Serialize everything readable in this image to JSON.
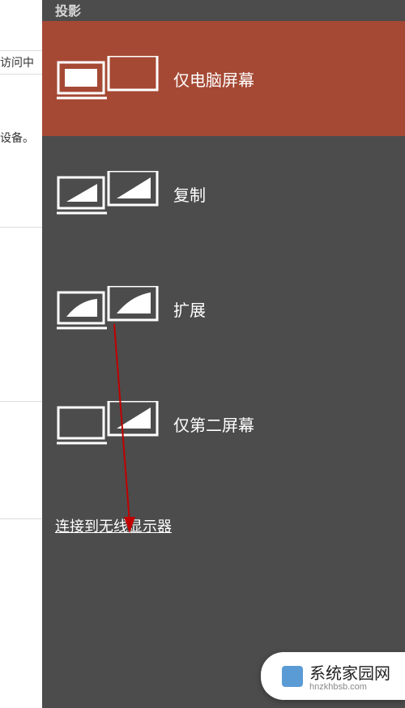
{
  "flyout": {
    "title": "投影",
    "options": [
      {
        "label": "仅电脑屏幕",
        "selected": true
      },
      {
        "label": "复制",
        "selected": false
      },
      {
        "label": "扩展",
        "selected": false
      },
      {
        "label": "仅第二屏幕",
        "selected": false
      }
    ],
    "wireless_link": "连接到无线显示器"
  },
  "background": {
    "text_fragment_1": "访问中",
    "text_fragment_2": "设备。"
  },
  "watermark": {
    "text": "系统家园网",
    "url": "hnzkhbsb.com"
  }
}
